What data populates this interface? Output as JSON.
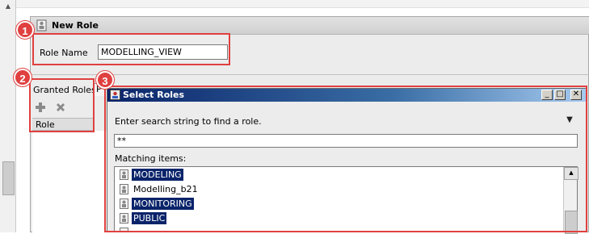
{
  "editor": {
    "title": "New Role",
    "role_name_label": "Role Name",
    "role_name_value": "MODELLING_VIEW",
    "granted_roles_label": "Granted Roles",
    "tab_stub": "P",
    "role_column_header": "Role"
  },
  "dialog": {
    "title": "Select Roles",
    "prompt": "Enter search string to find a role.",
    "search_value": "**",
    "matching_label": "Matching items:",
    "items": [
      {
        "label": "MODELING",
        "selected": true
      },
      {
        "label": "Modelling_b21",
        "selected": false
      },
      {
        "label": "MONITORING",
        "selected": true
      },
      {
        "label": "PUBLIC",
        "selected": true
      }
    ],
    "window_buttons": {
      "minimize": "_",
      "maximize": "□",
      "close": "✕"
    }
  },
  "annotations": [
    "1",
    "2",
    "3"
  ],
  "colors": {
    "annotation": "#e04040",
    "selection": "#0a246a",
    "titlebar": "#0a246a"
  }
}
